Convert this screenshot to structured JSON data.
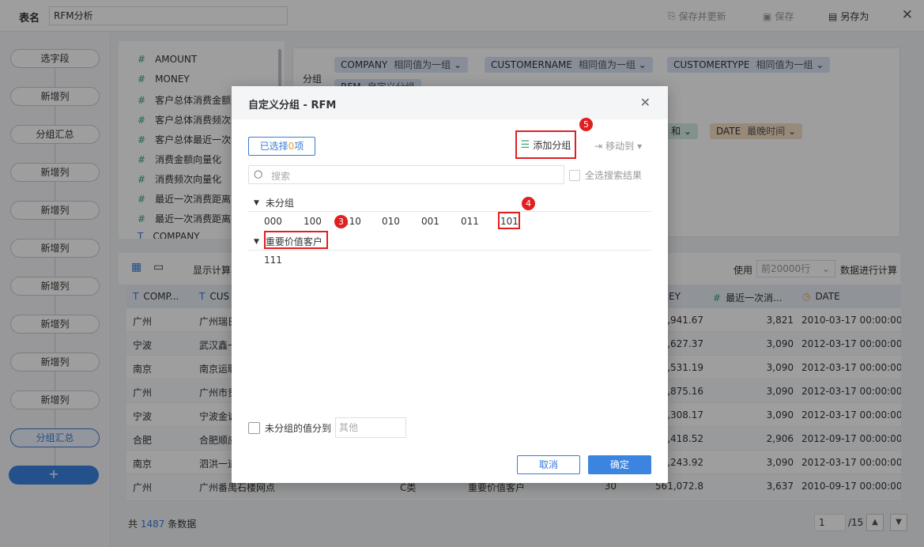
{
  "topbar": {
    "table_label": "表名",
    "table_name": "RFM分析",
    "save_update": "保存并更新",
    "save": "保存",
    "save_as": "另存为"
  },
  "rail": {
    "nodes": [
      "选字段",
      "新增列",
      "分组汇总",
      "新增列",
      "新增列",
      "新增列",
      "新增列",
      "新增列",
      "新增列",
      "新增列",
      "分组汇总"
    ],
    "add": "+"
  },
  "fields": [
    "AMOUNT",
    "MONEY",
    "客户总体消费金额",
    "客户总体消费频次",
    "客户总体最近一次",
    "消费金额向量化",
    "消费频次向量化",
    "最近一次消费距离",
    "最近一次消费距离",
    "COMPANY"
  ],
  "grouping": {
    "label": "分组",
    "tags": [
      {
        "name": "COMPANY",
        "sub": "相同值为一组"
      },
      {
        "name": "CUSTOMERNAME",
        "sub": "相同值为一组"
      },
      {
        "name": "CUSTOMERTYPE",
        "sub": "相同值为一组"
      },
      {
        "name": "RFM",
        "sub": "自定义分组"
      }
    ],
    "summary_tags": [
      {
        "name": "和",
        "sub": ""
      },
      {
        "name": "DATE",
        "sub": "最晚时间"
      }
    ]
  },
  "toolbar": {
    "show_calc": "显示计算",
    "use": "使用",
    "rows_select": "前20000行",
    "compute": "数据进行计算"
  },
  "grid": {
    "headers": [
      "COMP...",
      "CUS",
      "EY",
      "最近一次消...",
      "DATE"
    ],
    "rows": [
      [
        "广州",
        "广州瑞日",
        "4,941.67",
        "3,821",
        "2010-03-17 00:00:00"
      ],
      [
        "宁波",
        "武汉鑫一",
        "0,627.37",
        "3,090",
        "2012-03-17 00:00:00"
      ],
      [
        "南京",
        "南京运联",
        "3,531.19",
        "3,090",
        "2012-03-17 00:00:00"
      ],
      [
        "广州",
        "广州市贵",
        "9,875.16",
        "3,090",
        "2012-03-17 00:00:00"
      ],
      [
        "宁波",
        "宁波金诚",
        "2,308.17",
        "3,090",
        "2012-03-17 00:00:00"
      ],
      [
        "合肥",
        "合肥顺应",
        "5,418.52",
        "2,906",
        "2012-09-17 00:00:00"
      ],
      [
        "南京",
        "泗洪一道",
        "3,243.92",
        "3,090",
        "2012-03-17 00:00:00"
      ]
    ],
    "last_row": [
      "广州",
      "广州番禺石楼网点",
      "C类",
      "重要价值客户",
      "30",
      "561,072.8",
      "3,637",
      "2010-09-17 00:00:00"
    ]
  },
  "footer": {
    "prefix": "共",
    "count": "1487",
    "suffix": "条数据",
    "page": "1",
    "total": "/15"
  },
  "dialog": {
    "title": "自定义分组 - RFM",
    "selected_prefix": "已选择",
    "selected_count": "0",
    "selected_suffix": "项",
    "add_group": "添加分组",
    "move_to": "移动到",
    "search_placeholder": "搜索",
    "select_all_results": "全选搜索结果",
    "ungrouped_title": "未分组",
    "ungrouped_values": [
      "000",
      "100",
      "110",
      "010",
      "001",
      "011",
      "101"
    ],
    "group_title": "重要价值客户",
    "group_values": [
      "111"
    ],
    "bottom_check": "未分组的值分到",
    "other_placeholder": "其他",
    "cancel": "取消",
    "ok": "确定",
    "badges": [
      "3",
      "4",
      "5"
    ]
  }
}
